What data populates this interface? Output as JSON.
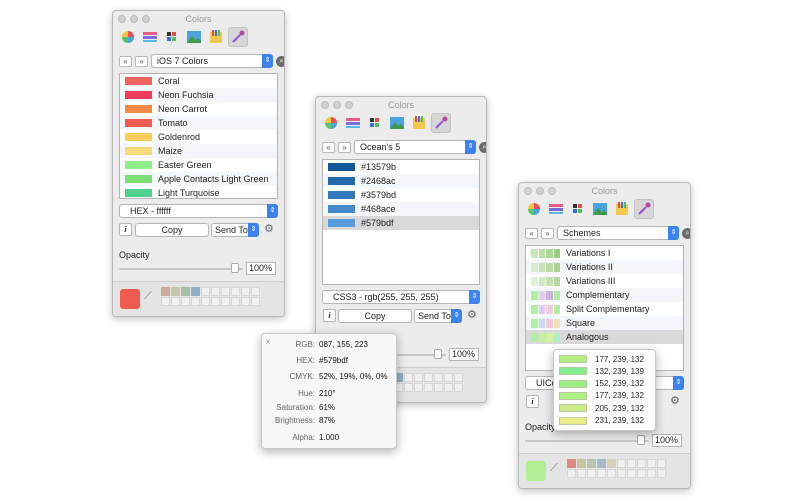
{
  "window1": {
    "title": "Colors",
    "palette_name": "iOS 7 Colors",
    "colors": [
      {
        "name": "Coral",
        "hex": "#f0655d"
      },
      {
        "name": "Neon Fuchsia",
        "hex": "#f03d5d"
      },
      {
        "name": "Neon Carrot",
        "hex": "#f28b48"
      },
      {
        "name": "Tomato",
        "hex": "#ef5c4f"
      },
      {
        "name": "Goldenrod",
        "hex": "#f9cd5e"
      },
      {
        "name": "Maize",
        "hex": "#f6d97a"
      },
      {
        "name": "Easter Green",
        "hex": "#8fef8a"
      },
      {
        "name": "Apple Contacts Light Green",
        "hex": "#7bde75"
      },
      {
        "name": "Light Turquoise",
        "hex": "#4fd28d"
      }
    ],
    "format_label": "HEX - ffffff",
    "copy_label": "Copy",
    "send_to_label": "Send To",
    "opacity_label": "Opacity",
    "opacity_value": "100%",
    "opacity_fraction": 1.0,
    "current_color": "#ef5a4e",
    "recent_swatches": [
      "#cfa99b",
      "#c2c7a8",
      "#a7bfa7",
      "#8fb0c8"
    ]
  },
  "window2": {
    "title": "Colors",
    "palette_name": "Ocean's 5",
    "colors": [
      {
        "name": "#13579b",
        "hex": "#13579b"
      },
      {
        "name": "#2468ac",
        "hex": "#2468ac"
      },
      {
        "name": "#3579bd",
        "hex": "#3579bd"
      },
      {
        "name": "#468ace",
        "hex": "#468ace"
      },
      {
        "name": "#579bdf",
        "hex": "#579bdf"
      }
    ],
    "selected_index": 4,
    "format_label": "CSS3 - rgb(255, 255, 255)",
    "copy_label": "Copy",
    "send_to_label": "Send To",
    "opacity_value": "100%",
    "recent_swatches": [
      "#cfa99b",
      "#c2c7a8",
      "#a7bfa7",
      "#8fb0c8"
    ]
  },
  "info_popover": {
    "close": "x",
    "rows": [
      {
        "key": "RGB:",
        "value": "087, 155, 223"
      },
      {
        "key": "HEX:",
        "value": "#579bdf"
      },
      {
        "key": "CMYK:",
        "value": "52%, 19%, 0%, 0%"
      },
      {
        "key": "Hue:",
        "value": "210°"
      },
      {
        "key": "Saturation:",
        "value": "61%"
      },
      {
        "key": "Brightness:",
        "value": "87%"
      },
      {
        "key": "Alpha:",
        "value": "1.000"
      }
    ]
  },
  "window3": {
    "title": "Colors",
    "palette_name": "Schemes",
    "schemes": [
      {
        "name": "Variations I",
        "colors": [
          "#c8e8b8",
          "#b9dfa6",
          "#aad693",
          "#9bcd82"
        ]
      },
      {
        "name": "Variations II",
        "colors": [
          "#d8ecc9",
          "#c9e3b8",
          "#badaa6",
          "#abd195"
        ]
      },
      {
        "name": "Variations III",
        "colors": [
          "#e3f1d6",
          "#d3e8c4",
          "#c3dfb3",
          "#b3d6a2"
        ]
      },
      {
        "name": "Complementary",
        "colors": [
          "#b1efa0",
          "#e4cfe8",
          "#cbb2e0",
          "#b1efa0"
        ]
      },
      {
        "name": "Split Complementary",
        "colors": [
          "#b1efa0",
          "#dcc9ef",
          "#efc9dc",
          "#b1efa0"
        ]
      },
      {
        "name": "Square",
        "colors": [
          "#b1efa0",
          "#c9d8ef",
          "#efc9d8",
          "#eee3b8"
        ]
      },
      {
        "name": "Analogous",
        "colors": [
          "#b1efa0",
          "#c4efa0",
          "#d7efa0",
          "#b1efc4"
        ]
      }
    ],
    "selected_index": 6,
    "format_label_partial": "UICo",
    "opacity_label": "Opacity",
    "opacity_value": "100%",
    "current_color": "#b0ef93",
    "recent_swatches": [
      "#e08a86",
      "#c9c4a3",
      "#b8c6b0",
      "#a9bac8",
      "#d9d0b8"
    ]
  },
  "analogous_popover": {
    "colors": [
      {
        "value": "177, 239, 132",
        "hex": "#b1ef84"
      },
      {
        "value": "132, 239, 139",
        "hex": "#84ef8b"
      },
      {
        "value": "152, 239, 132",
        "hex": "#98ef84"
      },
      {
        "value": "177, 239, 132",
        "hex": "#b1ef84"
      },
      {
        "value": "205, 239, 132",
        "hex": "#cdef84"
      },
      {
        "value": "231, 239, 132",
        "hex": "#e7ef84"
      }
    ]
  },
  "icons": {
    "tools": [
      "color-wheel-icon",
      "sliders-icon",
      "palettes-icon",
      "image-palette-icon",
      "crayons-icon",
      "eyedropper-icon"
    ]
  }
}
